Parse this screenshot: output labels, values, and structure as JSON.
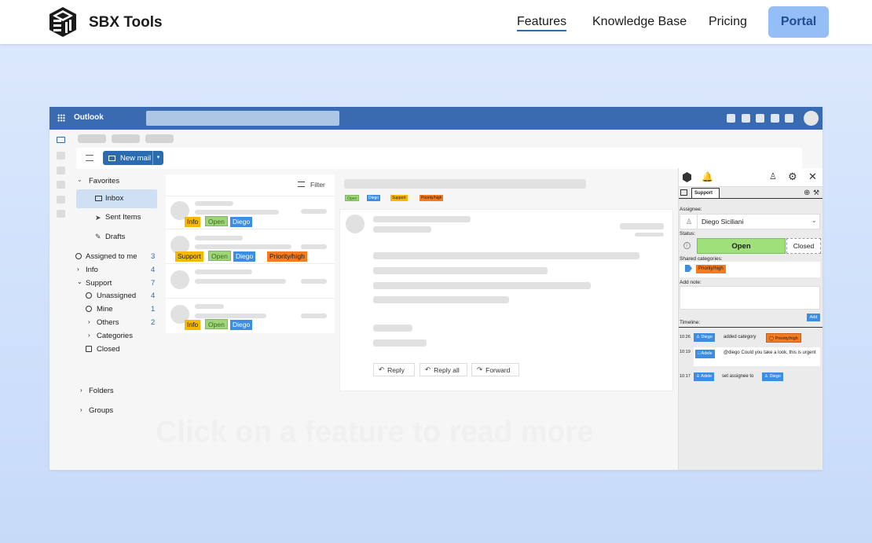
{
  "site": {
    "brand": "SBX Tools",
    "nav": [
      "Features",
      "Knowledge Base",
      "Pricing"
    ],
    "portal": "Portal",
    "overlay": "Click on a feature to read more"
  },
  "outlook": {
    "app_name": "Outlook",
    "new_mail": "New mail",
    "filter": "Filter",
    "favorites": "Favorites",
    "favorites_items": [
      "Inbox",
      "Sent Items",
      "Drafts"
    ],
    "assigned_to_me": {
      "label": "Assigned to me",
      "count": "3"
    },
    "info": {
      "label": "Info",
      "count": "4"
    },
    "support": {
      "label": "Support",
      "count": "7"
    },
    "unassigned": {
      "label": "Unassigned",
      "count": "4"
    },
    "mine": {
      "label": "Mine",
      "count": "1"
    },
    "others": {
      "label": "Others",
      "count": "2"
    },
    "categories": "Categories",
    "closed": "Closed",
    "folders": "Folders",
    "groups": "Groups",
    "tags": {
      "info": "Info",
      "open": "Open",
      "diego": "Diego",
      "support": "Support",
      "priority": "Priority/high"
    },
    "actions": {
      "reply": "Reply",
      "reply_all": "Reply all",
      "forward": "Forward"
    }
  },
  "addin": {
    "tab": "Support",
    "assignee_label": "Assignee:",
    "assignee": "Diego Siciliani",
    "status_label": "Status:",
    "status_open": "Open",
    "status_closed": "Closed",
    "shared_categories_label": "Shared categories:",
    "category": "Priority/high",
    "add_note_label": "Add note:",
    "add_button": "Add",
    "timeline_label": "Timeline:",
    "timeline": [
      {
        "time": "10:26",
        "user": "Diego",
        "text": "added category",
        "tag": "Priority/high"
      },
      {
        "time": "10:19",
        "user": "Adele",
        "text": "@diego Could you take a look, this is urgent"
      },
      {
        "time": "10:17",
        "user": "Adele",
        "text": "set assignee to",
        "tag": "Diego"
      }
    ]
  },
  "colors": {
    "accent": "#2b6cb0",
    "outlook_bar": "#3a6bb0",
    "portal_bg": "#95bdf6",
    "open": "#9fd57a",
    "info": "#f7b900",
    "priority": "#f47b20",
    "diego": "#3c8ee3"
  }
}
